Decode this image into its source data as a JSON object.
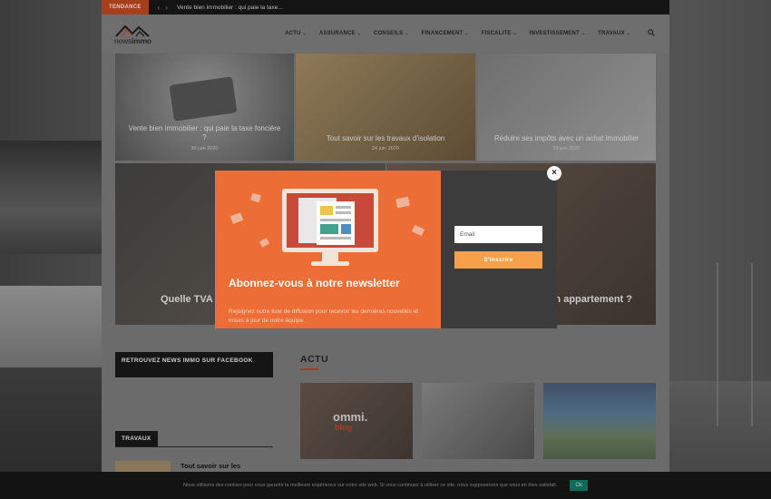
{
  "topbar": {
    "trend_label": "TENDANCE",
    "ticker": "Vente bien immobilier : qui paie la taxe..."
  },
  "logo": {
    "word_light": "news",
    "word_bold": "immo"
  },
  "menu": [
    {
      "label": "ACTU"
    },
    {
      "label": "ASSURANCE"
    },
    {
      "label": "CONSEILS"
    },
    {
      "label": "FINANCEMENT"
    },
    {
      "label": "FISCALITE"
    },
    {
      "label": "INVESTISSEMENT"
    },
    {
      "label": "TRAVAUX"
    }
  ],
  "featured": [
    {
      "title": "Vente bien immobilier : qui paie la taxe foncière ?",
      "date": "30 juin 2020"
    },
    {
      "title": "Tout savoir sur les travaux d'isolation",
      "date": "24 juin 2020"
    },
    {
      "title": "Réduire ses impôts avec un achat immobilier",
      "date": "19 juin 2020"
    },
    {
      "title": "Quelle TVA"
    },
    {
      "title": "on appartement ?"
    }
  ],
  "sidebar": {
    "facebook_heading": "RETROUVEZ NEWS IMMO SUR FACEBOOK",
    "travaux_heading": "TRAVAUX",
    "travaux_item": "Tout savoir sur les"
  },
  "actu": {
    "heading": "ACTU",
    "thumb1_brand": "ommi.",
    "thumb1_brand2": "blog"
  },
  "popup": {
    "title": "Abonnez-vous à notre newsletter",
    "description": "Rejoignez notre liste de diffusion pour recevoir les dernières nouvelles et mises à jour de notre équipe.",
    "email_placeholder": "Email",
    "subscribe_label": "S'inscrire",
    "close": "×"
  },
  "cookie": {
    "text": "Nous utilisons des cookies pour vous garantir la meilleure expérience sur notre site web. Si vous continuez à utiliser ce site, nous supposerons que vous en êtes satisfait.",
    "ok_label": "Ok"
  },
  "colors": {
    "accent": "#a53f1e",
    "popup_orange": "#ec6d35",
    "subscribe": "#f7a04a",
    "cookie_ok": "#0f6a57"
  }
}
